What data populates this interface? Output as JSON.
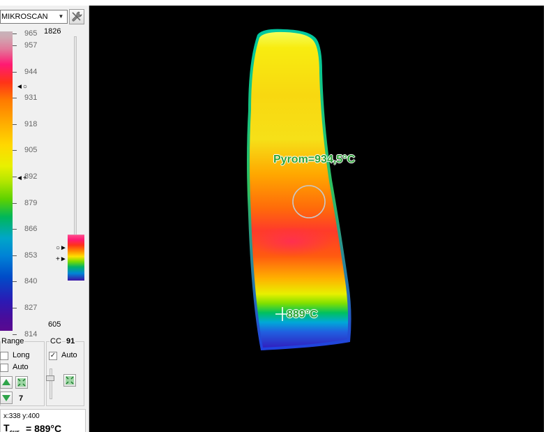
{
  "camera": {
    "selected": "MIKROSCAN"
  },
  "colorbar": {
    "max_value": "1826",
    "min_value": "605",
    "ticks": [
      "965",
      "957",
      "944",
      "931",
      "918",
      "905",
      "892",
      "879",
      "866",
      "853",
      "840",
      "827",
      "814"
    ]
  },
  "range_group": {
    "title": "Range",
    "long_label": "Long",
    "long_checked": false,
    "auto_label": "Auto",
    "auto_checked": false,
    "step_value": "7"
  },
  "cc_group": {
    "title": "CC",
    "value": "91",
    "auto_label": "Auto",
    "auto_checked": true
  },
  "status": {
    "coords": "x:338 y:400",
    "tcur_label": "T",
    "tcur_sub": "cur",
    "tcur_value": "= 889°C"
  },
  "image": {
    "pyrometer_label": "Pyrom=934,5°C",
    "spot_label": "889°C"
  },
  "icons": {
    "settings": "wrench-icon",
    "dropdown": "chevron-down-icon",
    "range_up": "arrow-up-icon",
    "range_down": "arrow-down-icon",
    "autorange": "fit-range-icon",
    "cc_apply": "apply-icon"
  }
}
